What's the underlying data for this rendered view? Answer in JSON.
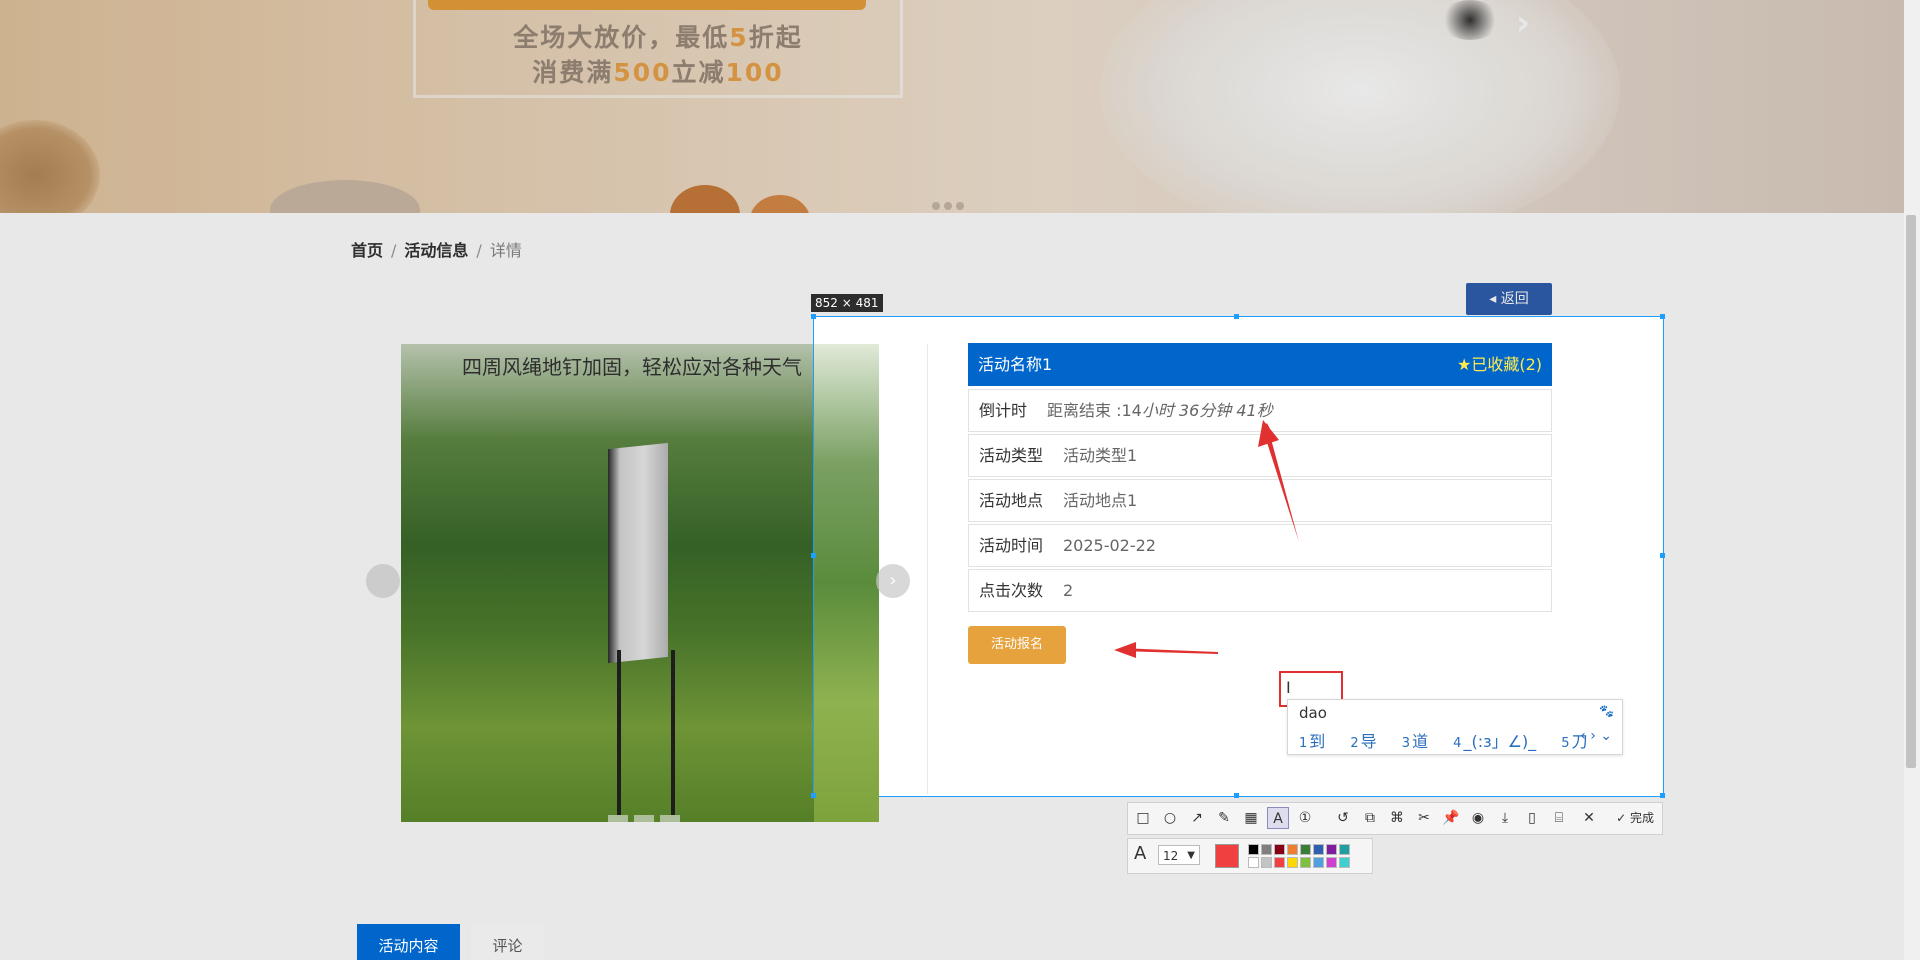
{
  "banner": {
    "promo_line1_a": "全场大放价，最低",
    "promo_line1_hl": "5",
    "promo_line1_b": "折起",
    "promo_line2_a": "消费满",
    "promo_line2_hl1": "500",
    "promo_line2_b": "立减",
    "promo_line2_hl2": "100",
    "next_glyph": "›"
  },
  "breadcrumb": {
    "home": "首页",
    "section": "活动信息",
    "current": "详情",
    "separator": "/"
  },
  "back_button": {
    "label": "◂ 返回"
  },
  "carousel": {
    "caption": "四周风绳地钉加固，轻松应对各种天气",
    "next_glyph": "›"
  },
  "capture": {
    "size_label": "852 × 481"
  },
  "activity": {
    "name": "活动名称1",
    "favorite": "★已收藏(2)",
    "rows": [
      {
        "label": "倒计时",
        "value_prefix": "距离结束 :14",
        "value_rest": "小时 36分钟 41秒"
      },
      {
        "label": "活动类型",
        "value": "活动类型1"
      },
      {
        "label": "活动地点",
        "value": "活动地点1"
      },
      {
        "label": "活动时间",
        "value": "2025-02-22"
      },
      {
        "label": "点击次数",
        "value": "2"
      }
    ],
    "signup_label": "活动报名"
  },
  "annotation": {
    "text_cursor": "I"
  },
  "ime": {
    "input": "dao",
    "candidates": [
      {
        "num": "1",
        "text": "到"
      },
      {
        "num": "2",
        "text": "导"
      },
      {
        "num": "3",
        "text": "道"
      },
      {
        "num": "4",
        "text": "_(:з」∠)_"
      },
      {
        "num": "5",
        "text": "刀"
      }
    ],
    "nav": "‹ › ⌄",
    "logo": "🐾"
  },
  "toolbar": {
    "tools": [
      "rectangle-icon",
      "ellipse-icon",
      "arrow-icon",
      "pen-icon",
      "mosaic-icon",
      "text-icon",
      "number-icon",
      "undo-icon",
      "ocr-icon",
      "translate-icon",
      "scissors-icon",
      "pin-icon",
      "record-icon",
      "save-icon",
      "long-screenshot-icon",
      "bookmark-icon",
      "close-icon"
    ],
    "done_label": "✓ 完成"
  },
  "style": {
    "font_size": "12",
    "current_color": "#f04040",
    "palette": [
      "#000000",
      "#7f7f7f",
      "#880015",
      "#ed7d31",
      "#3a7d3a",
      "#2f5fb0",
      "#7f1f9f",
      "#1f9f9f",
      "#ffffff",
      "#c3c3c3",
      "#f04040",
      "#ffd700",
      "#7fbf3f",
      "#4fa0e0",
      "#cf3fcf",
      "#3fcfcf"
    ]
  },
  "tabs": {
    "content": "活动内容",
    "comment": "评论"
  },
  "colors": {
    "primary": "#0066cc",
    "accent": "#e6a23c",
    "favorite": "#ffe94d",
    "annotation": "#e03030",
    "selection": "#1e9fff"
  }
}
